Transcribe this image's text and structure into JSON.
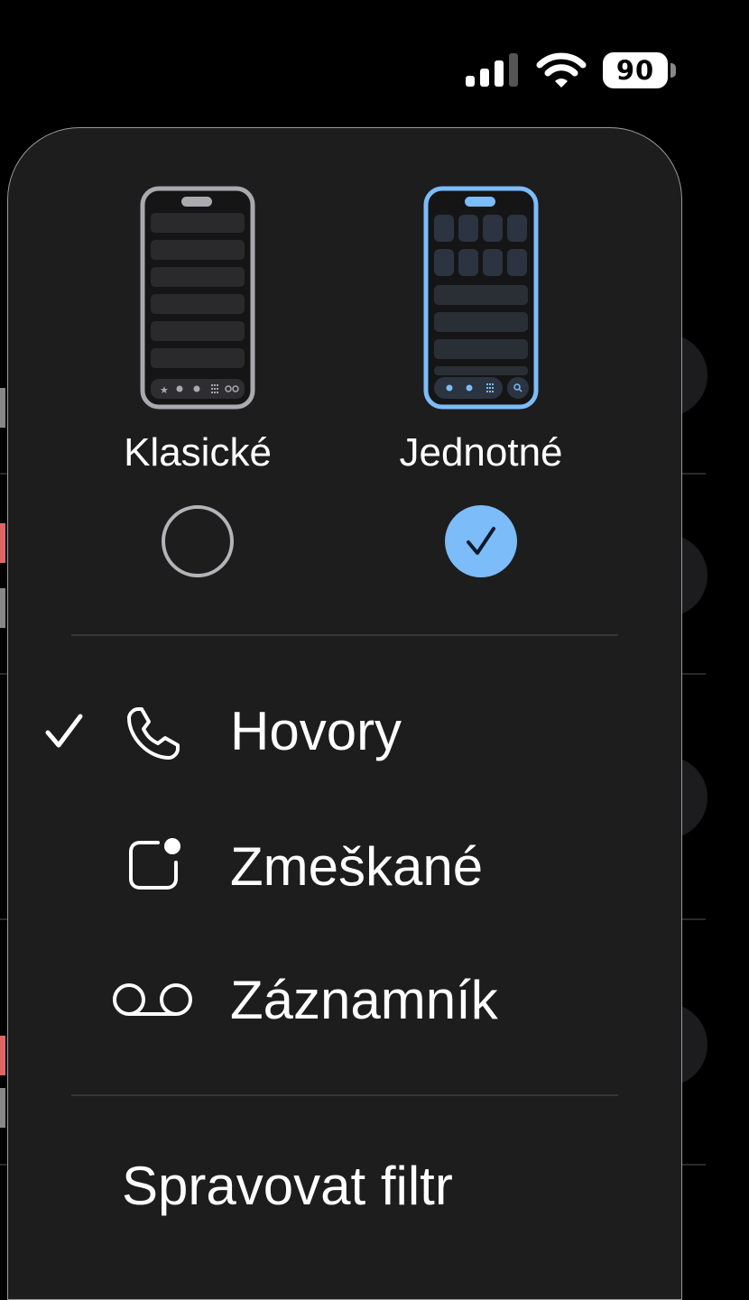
{
  "status_bar": {
    "battery_level": "90"
  },
  "menu": {
    "layout_options": [
      {
        "label": "Klasické",
        "selected": false
      },
      {
        "label": "Jednotné",
        "selected": true
      }
    ],
    "filter_items": [
      {
        "label": "Hovory",
        "icon": "phone-icon",
        "checked": true
      },
      {
        "label": "Zmeškané",
        "icon": "missed-call-icon",
        "checked": false
      },
      {
        "label": "Záznamník",
        "icon": "voicemail-icon",
        "checked": false
      }
    ],
    "manage_filter_label": "Spravovat filtr"
  },
  "colors": {
    "accent": "#7cbcf8",
    "menu_bg": "#1d1d1e",
    "classic_phone_outline": "#a9a9ae"
  }
}
